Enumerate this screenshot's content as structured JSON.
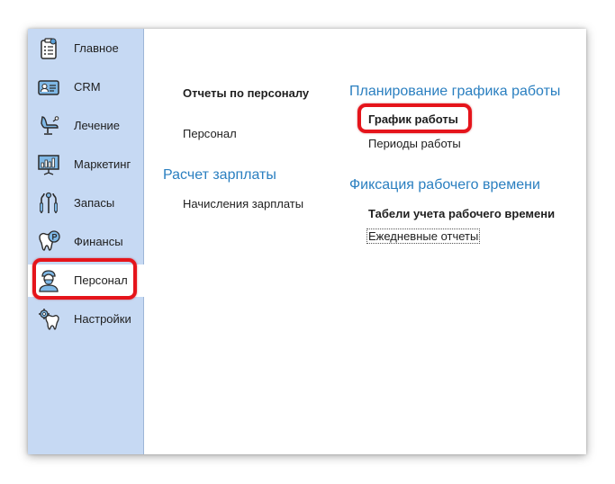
{
  "sidebar": {
    "items": [
      {
        "label": "Главное",
        "icon": "clipboard-icon"
      },
      {
        "label": "CRM",
        "icon": "id-card-icon"
      },
      {
        "label": "Лечение",
        "icon": "dental-chair-icon"
      },
      {
        "label": "Маркетинг",
        "icon": "chart-board-icon"
      },
      {
        "label": "Запасы",
        "icon": "dental-tools-icon"
      },
      {
        "label": "Финансы",
        "icon": "tooth-money-icon"
      },
      {
        "label": "Персонал",
        "icon": "doctor-icon"
      },
      {
        "label": "Настройки",
        "icon": "tooth-gear-icon"
      }
    ],
    "active_index": 6
  },
  "main": {
    "reports_heading": "Отчеты по персоналу",
    "personnel_link": "Персонал",
    "salary_title": "Расчет зарплаты",
    "salary_link": "Начисления зарплаты",
    "schedule_title": "Планирование графика работы",
    "schedule_link": "График работы",
    "periods_link": "Периоды работы",
    "timing_title": "Фиксация рабочего времени",
    "timesheets_heading": "Табели учета рабочего времени",
    "daily_link": "Ежедневные отчеты"
  },
  "colors": {
    "sidebar_bg": "#c6d9f3",
    "section_title": "#2a7fc0",
    "highlight": "#e5141b"
  }
}
